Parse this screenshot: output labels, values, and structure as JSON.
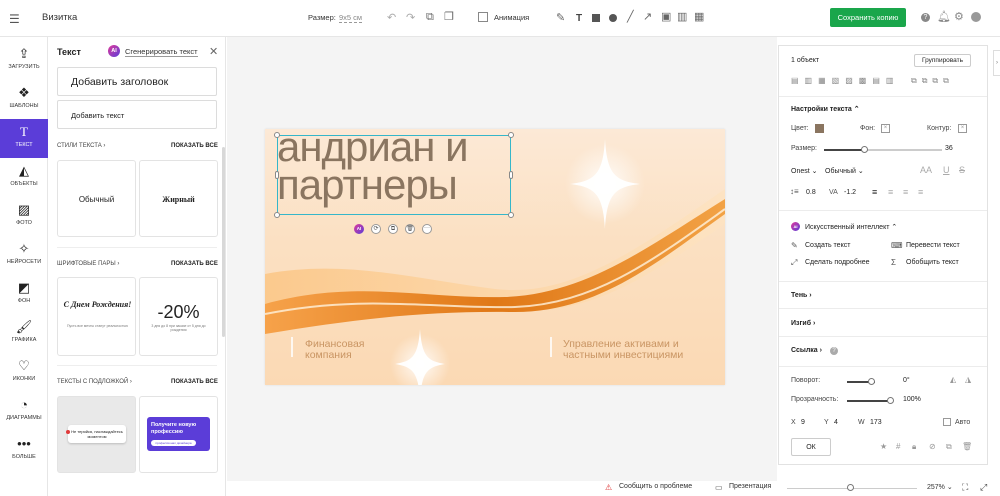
{
  "topbar": {
    "app_title": "Визитка",
    "size_label": "Размер:",
    "size_value": "9x5 см",
    "animation_label": "Анимация",
    "save_copy_label": "Сохранить копию",
    "accent": "#1aa64b"
  },
  "leftnav": {
    "items": [
      {
        "label": "Загрузить",
        "icon": "upload-icon"
      },
      {
        "label": "Шаблоны",
        "icon": "templates-icon"
      },
      {
        "label": "Текст",
        "icon": "text-icon"
      },
      {
        "label": "Объекты",
        "icon": "objects-icon"
      },
      {
        "label": "Фото",
        "icon": "photo-icon"
      },
      {
        "label": "Нейросети",
        "icon": "ai-wand-icon"
      },
      {
        "label": "Фон",
        "icon": "background-icon"
      },
      {
        "label": "Графика",
        "icon": "graphics-brush-icon"
      },
      {
        "label": "Иконки",
        "icon": "heart-icon"
      },
      {
        "label": "Диаграммы",
        "icon": "pie-chart-icon"
      },
      {
        "label": "Больше",
        "icon": "more-dots-icon"
      }
    ],
    "active": "Текст"
  },
  "panel": {
    "title": "Текст",
    "ai_badge": "AI",
    "generate_label": "Сгенерировать текст",
    "add_heading": "Добавить заголовок",
    "add_text": "Добавить текст",
    "styles_header": "Стили текста",
    "show_all": "Показать все",
    "style_normal": "Обычный",
    "style_bold": "Жирный",
    "pairs_header": "Шрифтовые пары",
    "pair1_title": "С Днем Рождения!",
    "pair1_sub": "Пусть все мечты станут реальностью",
    "pair2_title": "-20%",
    "pair2_sub": "3 дня до 8 при заказе от 5 дня до рождения",
    "backed_header": "Тексты с подложкой",
    "backed1": "Не теряйся, наслаждайтесь моментом",
    "backed2_title": "Получите новую профессию",
    "backed2_sub": "профессионал дизайнера",
    "backed2_color": "#5b3dd8"
  },
  "canvas": {
    "heading_line1": "андриан и",
    "heading_line2": "партнеры",
    "left_caption": "Финансовая компания",
    "right_caption": "Управление активами и частными инвестициями",
    "heading_color": "#8a7560"
  },
  "rightpanel": {
    "objects_count": "1 объект",
    "group_label": "Группировать",
    "text_settings": "Настройки текста",
    "color_label": "Цвет:",
    "bg_label": "Фон:",
    "outline_label": "Контур:",
    "size_label": "Размер:",
    "size_value": "36",
    "font_name": "Onest",
    "font_weight": "Обычный",
    "line_height": "0.8",
    "letter_spacing": "-1.2",
    "va_label": "VA",
    "ai_section": "Искусственный интеллект",
    "ai_create": "Создать текст",
    "ai_translate": "Перевести текст",
    "ai_detail": "Сделать подробнее",
    "ai_summarize": "Обобщить текст",
    "shadow": "Тень",
    "bend": "Изгиб",
    "link": "Ссылка",
    "rotation_label": "Поворот:",
    "rotation_value": "0°",
    "opacity_label": "Прозрачность:",
    "opacity_value": "100%",
    "x_label": "X",
    "x_value": "9",
    "y_label": "Y",
    "y_value": "4",
    "w_label": "W",
    "w_value": "173",
    "auto_label": "Авто",
    "ok_label": "ОК"
  },
  "bottombar": {
    "report": "Сообщить о проблеме",
    "presentation": "Презентация",
    "zoom": "257%"
  }
}
